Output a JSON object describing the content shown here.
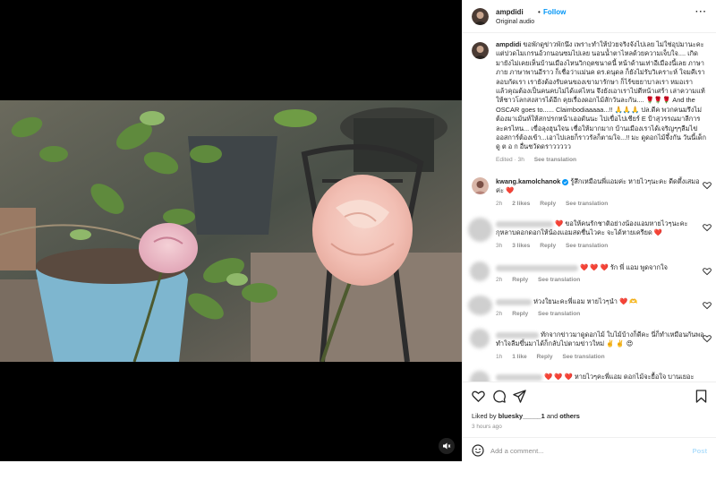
{
  "post": {
    "username": "ampdidi",
    "dot": "•",
    "follow_label": "Follow",
    "audio_label": "Original audio"
  },
  "caption": {
    "username": "ampdidi",
    "text": "ขอพักดูข่าวพักนึง เพราะทำให้ป่วยจริงจังไปเลย ไม่ใช่อุปมานะคะ แต่ปวดไมเกรนอ้วกนอนซมไปเลย นอนน้ำตาไหลด้วยความเจ็บใจ.... เกิดมายังไม่เคยเห็นบ้านเมืองไหนวิกฤตขนาดนี้ หน้าด้านเท่าอีเมืองนี้เลย ภาษาภาย ภาษาพานอีราว ก็เชื่อว่าแม่นค ดร.ดนุดล ก็ยังไม่รับวิเคราะห์ ใจมคีเรา ลอบกัดเรา เรายังต้องรับคนของเขามารักษา ก็ไร้ขยยาบาลเรา หมอเรา แล้วคุณต้องเป็นคนคบไม่ได้แค่ไหน จึงยังเอาเราไปตีหน้าเศร้า เล่าความแท้ให้ชาวโลกสงสารได้อีก คุยเรื่องดอกไม้สักวันละกัน.... 🌹🌹🌹 And the OSCAR goes to...... Claimbodiaaaaa...!! 🙏🙏🙏 ปล.ดีค พวกคนมรึงไม่ต้องมาเม้นท์ให้สกปรกหน้าเออดันนะ ไปเขื่อไปเชียร์ E ป้าสุวรรณมาลีการละครไหน... เขื่อลุงฮุนใจน เชื่อให้มากมาก บ้านเมืองเราได้เจริญๆๆลืมไข่ ออสการ์ต้องเข้า...เอาไปเลยก็ราวรัลก็ตามใจ...!! มะ ดูดอกไม้จึ้งกัน วันนี้เด็กดู ต อ ก อื่นชวัดดราววววว",
    "edited": "Edited · 3h",
    "see_translation": "See translation"
  },
  "comments": [
    {
      "username": "kwang.kamolchanok",
      "text": "รู้สึกเหมือนพี่แอมค่ะ หายไวๆนะคะ ดีดตึ้งเสมอค่ะ ❤️",
      "time": "2h",
      "likes": "2 likes",
      "reply": "Reply",
      "see_translation": "See translation"
    },
    {
      "username": "",
      "text": "❤️ ขอให้คนรักชาติอย่างน้องแอมหายไวๆนะคะ กุหลาบดอกดอกให้น้องแอมสดชื่นไวคะ จะได้หายเครียด ❤️",
      "time": "3h",
      "likes": "3 likes",
      "reply": "Reply",
      "see_translation": "See translation"
    },
    {
      "username": "",
      "text": "❤️ ❤️ ❤️ รัก พี่ แอม พูดจากใจ",
      "time": "2h",
      "likes": "",
      "reply": "Reply",
      "see_translation": "See translation"
    },
    {
      "username": "",
      "text": "ห่วงใยนะคะพี่แอม หายไวๆนำ ❤️ 🫶",
      "time": "2h",
      "likes": "",
      "reply": "Reply",
      "see_translation": "See translation"
    },
    {
      "username": "",
      "text": "ทักจากข่าวมาดูดอกไม้ ใบไม้บ้างก็ดีคะ นี่ก็ทำเหมือนกันพอทำใจลืมขึ้นมาได้ก็กลับไปตามข่าวใหม่ ✌️ ✌️ 😍",
      "time": "1h",
      "likes": "1 like",
      "reply": "Reply",
      "see_translation": "See translation"
    },
    {
      "username": "",
      "text": "❤️ ❤️ ❤️ หายไวๆคะพี่แอม ดอกไม้จะยื้อใจ บานเยอะ",
      "time": "",
      "likes": "",
      "reply": "",
      "see_translation": ""
    }
  ],
  "footer": {
    "liked_by_prefix": "Liked by",
    "liked_by_user": "bluesky_____1",
    "and_label": "and",
    "others_label": "others",
    "time_ago": "3 hours ago",
    "add_comment_placeholder": "Add a comment...",
    "post_label": "Post"
  },
  "icons": {
    "like": "heart-icon",
    "comment": "comment-icon",
    "share": "share-icon",
    "save": "bookmark-icon",
    "emoji": "emoji-icon",
    "more": "more-icon",
    "audio": "speaker-muted-icon"
  },
  "colors": {
    "accent": "#0095f6",
    "text": "#262626",
    "muted": "#8e8e8e",
    "heart": "#ed4956"
  }
}
